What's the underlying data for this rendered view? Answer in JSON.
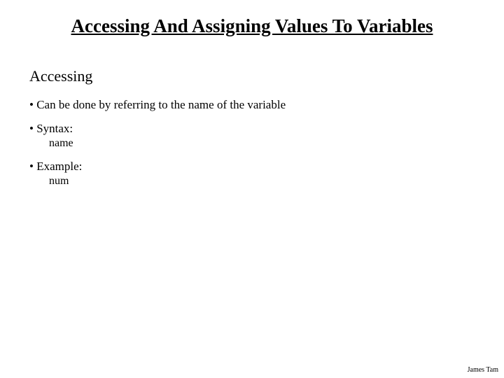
{
  "title": "Accessing And Assigning Values To Variables",
  "subtitle": "Accessing",
  "bullets": {
    "b1": "• Can be done by referring to the name of the variable",
    "b2": "• Syntax:",
    "b2_sub": "name",
    "b3": "• Example:",
    "b3_sub": "num"
  },
  "footer": "James Tam"
}
